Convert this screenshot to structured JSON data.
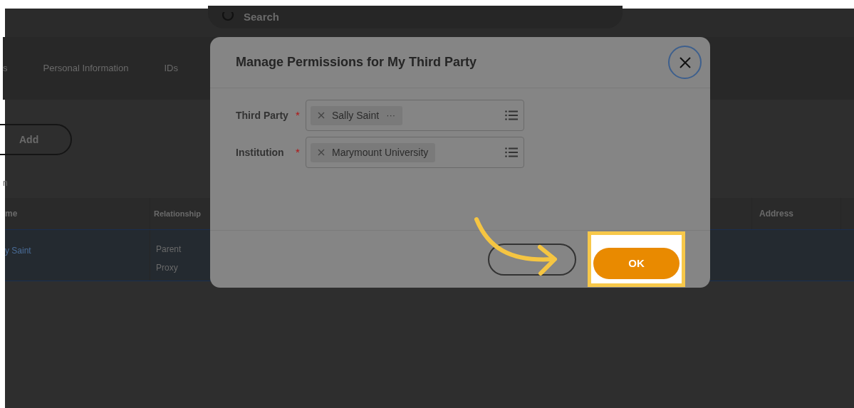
{
  "search": {
    "placeholder": "Search"
  },
  "tabs": [
    {
      "label": "s",
      "selected": false
    },
    {
      "label": "Personal Information",
      "selected": false
    },
    {
      "label": "IDs",
      "selected": false
    }
  ],
  "add_button": "Add",
  "section_label": "n",
  "table": {
    "columns": [
      "me",
      "Relationship",
      "Address"
    ],
    "rows": [
      {
        "name": "y Saint",
        "relationship": [
          "Parent",
          "Proxy"
        ],
        "selected": true
      }
    ]
  },
  "dialog": {
    "title": "Manage Permissions for My Third Party",
    "fields": [
      {
        "label": "Third Party",
        "required_mark": "*",
        "value": "Sally Saint",
        "more": "···"
      },
      {
        "label": "Institution",
        "required_mark": "*",
        "value": "Marymount University"
      }
    ],
    "ok": "OK",
    "ok_highlighted": true
  }
}
